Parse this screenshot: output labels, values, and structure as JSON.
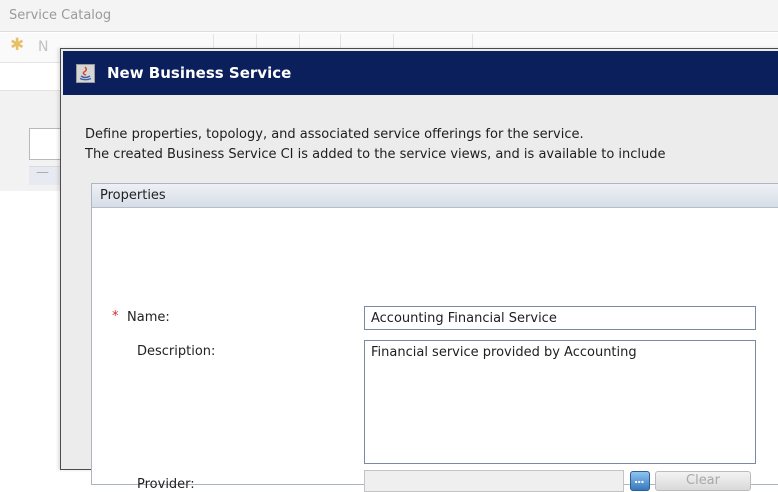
{
  "background_app": {
    "title": "Service Catalog",
    "toolbar_partial_label": "N",
    "left_row_glyph": "—"
  },
  "dialog": {
    "title": "New Business Service",
    "intro_line1": "Define properties, topology, and associated service offerings for the service.",
    "intro_line2": "The created Business Service CI is added to the service views, and is available to include",
    "properties_panel": {
      "title": "Properties",
      "required_marker": "*",
      "name_label": "Name:",
      "name_value": "Accounting Financial Service",
      "description_label": "Description:",
      "description_value": "Financial service provided by Accounting",
      "provider_label": "Provider:",
      "provider_value": "",
      "browse_label": "...",
      "clear_label": "Clear"
    }
  },
  "colors": {
    "dialog_titlebar": "#0b1f5c",
    "required_star": "#d42a2a",
    "new_star": "#e8c06a"
  }
}
